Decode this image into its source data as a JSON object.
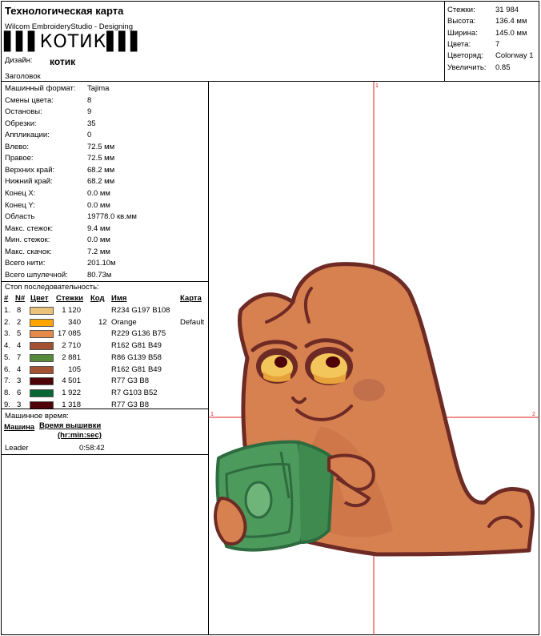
{
  "header": {
    "title": "Технологическая карта",
    "subtitle": "Wilcom EmbroideryStudio - Designing",
    "barcode_text": "КОТИК",
    "design_label": "Дизайн:",
    "design_name": "котик",
    "heading_label": "Заголовок"
  },
  "summary": [
    {
      "label": "Стежки:",
      "value": "31 984"
    },
    {
      "label": "Высота:",
      "value": "136.4 мм"
    },
    {
      "label": "Ширина:",
      "value": "145.0 мм"
    },
    {
      "label": "Цвета:",
      "value": "7"
    },
    {
      "label": "Цветоряд:",
      "value": "Colorway 1"
    },
    {
      "label": "Увеличить:",
      "value": "0.85"
    }
  ],
  "details": [
    {
      "label": "Машинный формат:",
      "value": "Tajima"
    },
    {
      "label": "Смены цвета:",
      "value": "8"
    },
    {
      "label": "Остановы:",
      "value": "9"
    },
    {
      "label": "Обрезки:",
      "value": "35"
    },
    {
      "label": "Аппликации:",
      "value": "0"
    },
    {
      "label": "Влево:",
      "value": "72.5 мм"
    },
    {
      "label": "Правое:",
      "value": "72.5 мм"
    },
    {
      "label": "Верхних край:",
      "value": "68.2 мм"
    },
    {
      "label": "Нижний край:",
      "value": "68.2 мм"
    },
    {
      "label": "Конец X:",
      "value": "0.0 мм"
    },
    {
      "label": "Конец Y:",
      "value": "0.0 мм"
    },
    {
      "label": "Область",
      "value": "19778.0 кв.мм"
    },
    {
      "label": "Макс. стежок:",
      "value": "9.4 мм"
    },
    {
      "label": "Мин. стежок:",
      "value": "0.0 мм"
    },
    {
      "label": "Макс. скачок:",
      "value": "7.2 мм"
    },
    {
      "label": "Всего нити:",
      "value": "201.10м"
    },
    {
      "label": "Всего шпулечной:",
      "value": "80.73м"
    }
  ],
  "sequence": {
    "title": "Стоп последовательность:",
    "headers": {
      "num": "#",
      "n": "N#",
      "color": "Цвет",
      "stitches": "Стежки",
      "code": "Код",
      "name": "Имя",
      "chart": "Карта"
    },
    "rows": [
      {
        "num": "1.",
        "n": "8",
        "color": "#EAC27A",
        "stitches": "1 120",
        "code": "",
        "name": "R234 G197 B108",
        "chart": ""
      },
      {
        "num": "2.",
        "n": "2",
        "color": "#FFA500",
        "stitches": "340",
        "code": "12",
        "name": "Orange",
        "chart": "Default"
      },
      {
        "num": "3.",
        "n": "5",
        "color": "#E5884B",
        "stitches": "17 085",
        "code": "",
        "name": "R229 G136 B75",
        "chart": ""
      },
      {
        "num": "4.",
        "n": "4",
        "color": "#A25131",
        "stitches": "2 710",
        "code": "",
        "name": "R162 G81 B49",
        "chart": ""
      },
      {
        "num": "5.",
        "n": "7",
        "color": "#568B3A",
        "stitches": "2 881",
        "code": "",
        "name": "R86 G139 B58",
        "chart": ""
      },
      {
        "num": "6.",
        "n": "4",
        "color": "#A25131",
        "stitches": "105",
        "code": "",
        "name": "R162 G81 B49",
        "chart": ""
      },
      {
        "num": "7.",
        "n": "3",
        "color": "#4D0308",
        "stitches": "4 501",
        "code": "",
        "name": "R77 G3 B8",
        "chart": ""
      },
      {
        "num": "8.",
        "n": "6",
        "color": "#076734",
        "stitches": "1 922",
        "code": "",
        "name": "R7 G103 B52",
        "chart": ""
      },
      {
        "num": "9.",
        "n": "3",
        "color": "#4D0308",
        "stitches": "1 318",
        "code": "",
        "name": "R77 G3 B8",
        "chart": ""
      }
    ]
  },
  "machine_time": {
    "title": "Машинное время:",
    "col_machine": "Машина",
    "col_time": "Время вышивки",
    "col_time_unit": "(hr:min:sec)",
    "rows": [
      {
        "machine": "Leader",
        "time": "0:58:42"
      }
    ]
  },
  "axis_marks": {
    "top": "1",
    "left": "1",
    "right": "2"
  },
  "colors": {
    "crosshair": "#E02020",
    "outline": "#6E2A24"
  }
}
